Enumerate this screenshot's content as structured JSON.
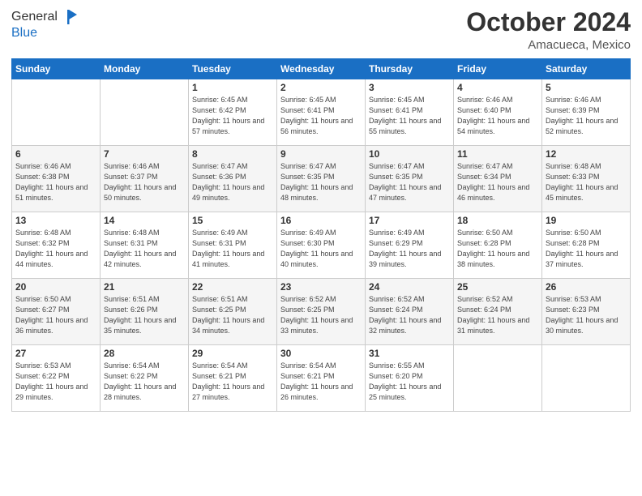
{
  "header": {
    "logo_line1": "General",
    "logo_line2": "Blue",
    "month": "October 2024",
    "location": "Amacueca, Mexico"
  },
  "weekdays": [
    "Sunday",
    "Monday",
    "Tuesday",
    "Wednesday",
    "Thursday",
    "Friday",
    "Saturday"
  ],
  "weeks": [
    [
      {
        "day": "",
        "info": ""
      },
      {
        "day": "",
        "info": ""
      },
      {
        "day": "1",
        "info": "Sunrise: 6:45 AM\nSunset: 6:42 PM\nDaylight: 11 hours and 57 minutes."
      },
      {
        "day": "2",
        "info": "Sunrise: 6:45 AM\nSunset: 6:41 PM\nDaylight: 11 hours and 56 minutes."
      },
      {
        "day": "3",
        "info": "Sunrise: 6:45 AM\nSunset: 6:41 PM\nDaylight: 11 hours and 55 minutes."
      },
      {
        "day": "4",
        "info": "Sunrise: 6:46 AM\nSunset: 6:40 PM\nDaylight: 11 hours and 54 minutes."
      },
      {
        "day": "5",
        "info": "Sunrise: 6:46 AM\nSunset: 6:39 PM\nDaylight: 11 hours and 52 minutes."
      }
    ],
    [
      {
        "day": "6",
        "info": "Sunrise: 6:46 AM\nSunset: 6:38 PM\nDaylight: 11 hours and 51 minutes."
      },
      {
        "day": "7",
        "info": "Sunrise: 6:46 AM\nSunset: 6:37 PM\nDaylight: 11 hours and 50 minutes."
      },
      {
        "day": "8",
        "info": "Sunrise: 6:47 AM\nSunset: 6:36 PM\nDaylight: 11 hours and 49 minutes."
      },
      {
        "day": "9",
        "info": "Sunrise: 6:47 AM\nSunset: 6:35 PM\nDaylight: 11 hours and 48 minutes."
      },
      {
        "day": "10",
        "info": "Sunrise: 6:47 AM\nSunset: 6:35 PM\nDaylight: 11 hours and 47 minutes."
      },
      {
        "day": "11",
        "info": "Sunrise: 6:47 AM\nSunset: 6:34 PM\nDaylight: 11 hours and 46 minutes."
      },
      {
        "day": "12",
        "info": "Sunrise: 6:48 AM\nSunset: 6:33 PM\nDaylight: 11 hours and 45 minutes."
      }
    ],
    [
      {
        "day": "13",
        "info": "Sunrise: 6:48 AM\nSunset: 6:32 PM\nDaylight: 11 hours and 44 minutes."
      },
      {
        "day": "14",
        "info": "Sunrise: 6:48 AM\nSunset: 6:31 PM\nDaylight: 11 hours and 42 minutes."
      },
      {
        "day": "15",
        "info": "Sunrise: 6:49 AM\nSunset: 6:31 PM\nDaylight: 11 hours and 41 minutes."
      },
      {
        "day": "16",
        "info": "Sunrise: 6:49 AM\nSunset: 6:30 PM\nDaylight: 11 hours and 40 minutes."
      },
      {
        "day": "17",
        "info": "Sunrise: 6:49 AM\nSunset: 6:29 PM\nDaylight: 11 hours and 39 minutes."
      },
      {
        "day": "18",
        "info": "Sunrise: 6:50 AM\nSunset: 6:28 PM\nDaylight: 11 hours and 38 minutes."
      },
      {
        "day": "19",
        "info": "Sunrise: 6:50 AM\nSunset: 6:28 PM\nDaylight: 11 hours and 37 minutes."
      }
    ],
    [
      {
        "day": "20",
        "info": "Sunrise: 6:50 AM\nSunset: 6:27 PM\nDaylight: 11 hours and 36 minutes."
      },
      {
        "day": "21",
        "info": "Sunrise: 6:51 AM\nSunset: 6:26 PM\nDaylight: 11 hours and 35 minutes."
      },
      {
        "day": "22",
        "info": "Sunrise: 6:51 AM\nSunset: 6:25 PM\nDaylight: 11 hours and 34 minutes."
      },
      {
        "day": "23",
        "info": "Sunrise: 6:52 AM\nSunset: 6:25 PM\nDaylight: 11 hours and 33 minutes."
      },
      {
        "day": "24",
        "info": "Sunrise: 6:52 AM\nSunset: 6:24 PM\nDaylight: 11 hours and 32 minutes."
      },
      {
        "day": "25",
        "info": "Sunrise: 6:52 AM\nSunset: 6:24 PM\nDaylight: 11 hours and 31 minutes."
      },
      {
        "day": "26",
        "info": "Sunrise: 6:53 AM\nSunset: 6:23 PM\nDaylight: 11 hours and 30 minutes."
      }
    ],
    [
      {
        "day": "27",
        "info": "Sunrise: 6:53 AM\nSunset: 6:22 PM\nDaylight: 11 hours and 29 minutes."
      },
      {
        "day": "28",
        "info": "Sunrise: 6:54 AM\nSunset: 6:22 PM\nDaylight: 11 hours and 28 minutes."
      },
      {
        "day": "29",
        "info": "Sunrise: 6:54 AM\nSunset: 6:21 PM\nDaylight: 11 hours and 27 minutes."
      },
      {
        "day": "30",
        "info": "Sunrise: 6:54 AM\nSunset: 6:21 PM\nDaylight: 11 hours and 26 minutes."
      },
      {
        "day": "31",
        "info": "Sunrise: 6:55 AM\nSunset: 6:20 PM\nDaylight: 11 hours and 25 minutes."
      },
      {
        "day": "",
        "info": ""
      },
      {
        "day": "",
        "info": ""
      }
    ]
  ]
}
